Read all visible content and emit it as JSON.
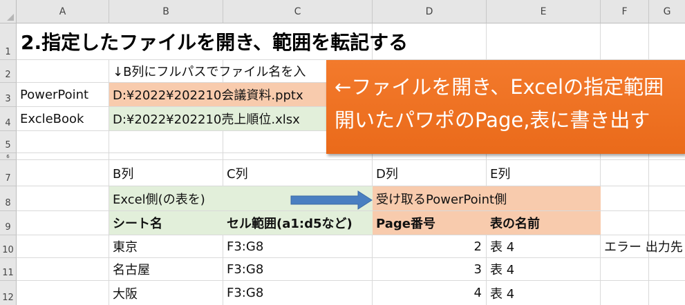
{
  "columns": [
    "A",
    "B",
    "C",
    "D",
    "E",
    "F",
    "G"
  ],
  "rows": [
    "1",
    "2",
    "3",
    "4",
    "5",
    "6",
    "7",
    "8",
    "9",
    "10",
    "11",
    "12"
  ],
  "title": "2.指定したファイルを開き、範囲を転記する",
  "note_row2": "↓B列にフルパスでファイル名を入",
  "powerpoint_label": "PowerPoint",
  "powerpoint_path": "D:¥2022¥202210会議資料.pptx",
  "excel_label": "ExcleBook",
  "excel_path": "D:¥2022¥202210売上順位.xlsx",
  "col_labels": {
    "b": "B列",
    "c": "C列",
    "d": "D列",
    "e": "E列"
  },
  "excel_side": "Excel側(の表を)",
  "ppt_side": "受け取るPowerPoint側",
  "headers": {
    "sheet": "シート名",
    "range": "セル範囲(a1:d5など)",
    "page": "Page番号",
    "table": "表の名前"
  },
  "data_rows": [
    {
      "sheet": "東京",
      "range": "F3:G8",
      "page": "2",
      "table": "表 4"
    },
    {
      "sheet": "名古屋",
      "range": "F3:G8",
      "page": "3",
      "table": "表 4"
    },
    {
      "sheet": "大阪",
      "range": "F3:G8",
      "page": "4",
      "table": "表 4"
    }
  ],
  "error_note": "エラー 出力先",
  "callout": {
    "line1": "←ファイルを開き、Excelの指定範囲",
    "line2": "開いたパワポのPage,表に書き出す"
  },
  "colors": {
    "green": "#e2efda",
    "peach": "#f8cbad",
    "callout": "#f07424",
    "arrow": "#4a7fc1"
  }
}
